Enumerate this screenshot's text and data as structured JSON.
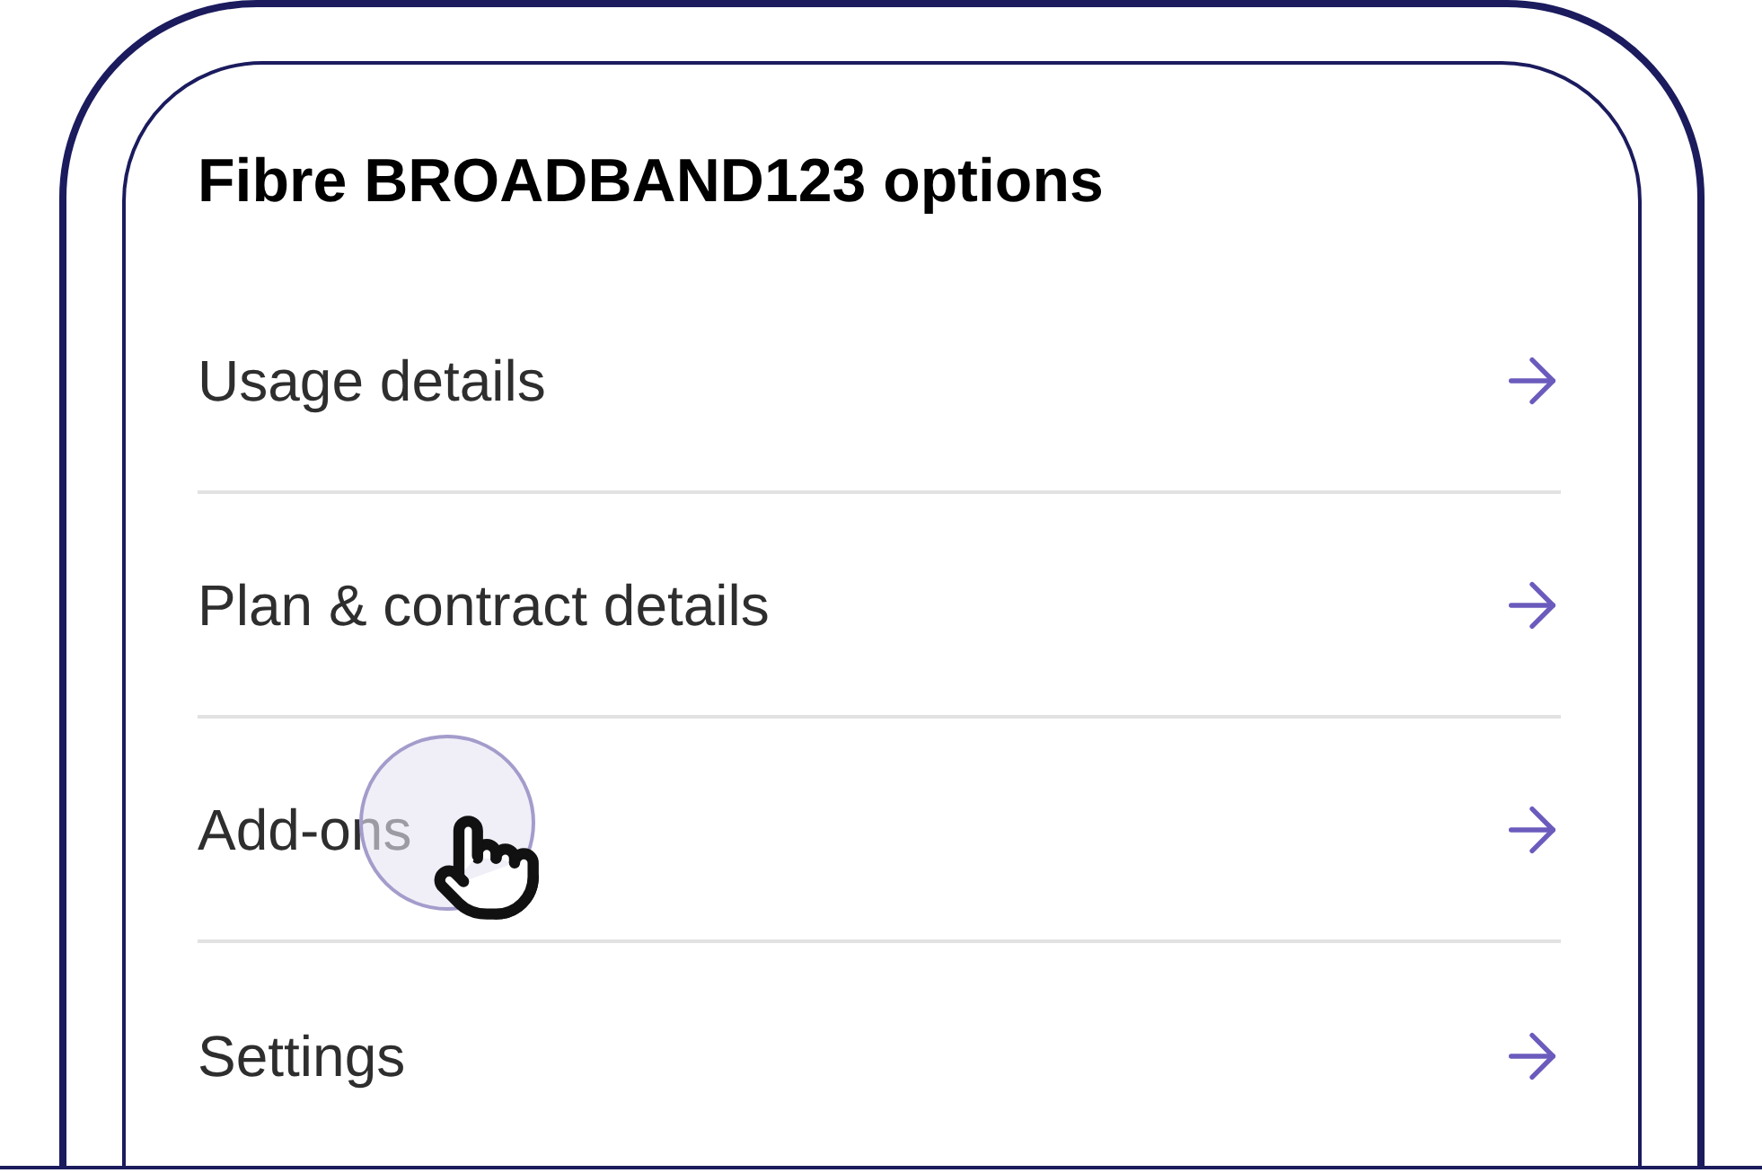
{
  "title": "Fibre BROADBAND123 options",
  "items": [
    {
      "label": "Usage details",
      "tapped": false
    },
    {
      "label": "Plan & contract details",
      "tapped": false
    },
    {
      "label": "Add-ons",
      "tapped": true
    },
    {
      "label": "Settings",
      "tapped": false
    }
  ]
}
